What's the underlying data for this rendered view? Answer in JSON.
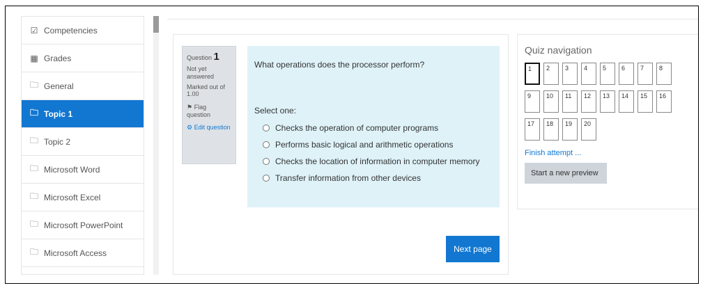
{
  "sidebar": {
    "items": [
      {
        "label": "Competencies",
        "icon": "checkbox-icon"
      },
      {
        "label": "Grades",
        "icon": "table-icon"
      },
      {
        "label": "General",
        "icon": "folder-icon"
      },
      {
        "label": "Topic 1",
        "icon": "folder-icon",
        "active": true
      },
      {
        "label": "Topic 2",
        "icon": "folder-icon"
      },
      {
        "label": "Microsoft Word",
        "icon": "folder-icon"
      },
      {
        "label": "Microsoft Excel",
        "icon": "folder-icon"
      },
      {
        "label": "Microsoft PowerPoint",
        "icon": "folder-icon"
      },
      {
        "label": "Microsoft Access",
        "icon": "folder-icon"
      }
    ]
  },
  "question": {
    "prefix": "Question",
    "number": "1",
    "status": "Not yet answered",
    "marked": "Marked out of 1.00",
    "flag_label": "Flag question",
    "edit_label": "Edit question",
    "text": "What operations does the processor perform?",
    "select_label": "Select one:",
    "options": [
      "Checks the operation of computer programs",
      "Performs basic logical and arithmetic operations",
      "Checks the location of information in computer memory",
      "Transfer information from other devices"
    ],
    "next_label": "Next page"
  },
  "quiz_nav": {
    "title": "Quiz navigation",
    "buttons": [
      "1",
      "2",
      "3",
      "4",
      "5",
      "6",
      "7",
      "8",
      "9",
      "10",
      "11",
      "12",
      "13",
      "14",
      "15",
      "16",
      "17",
      "18",
      "19",
      "20"
    ],
    "current": "1",
    "finish_label": "Finish attempt ...",
    "start_label": "Start a new preview"
  },
  "colors": {
    "accent": "#1177d1",
    "question_bg": "#def2f8",
    "info_bg": "#dee2e6"
  }
}
